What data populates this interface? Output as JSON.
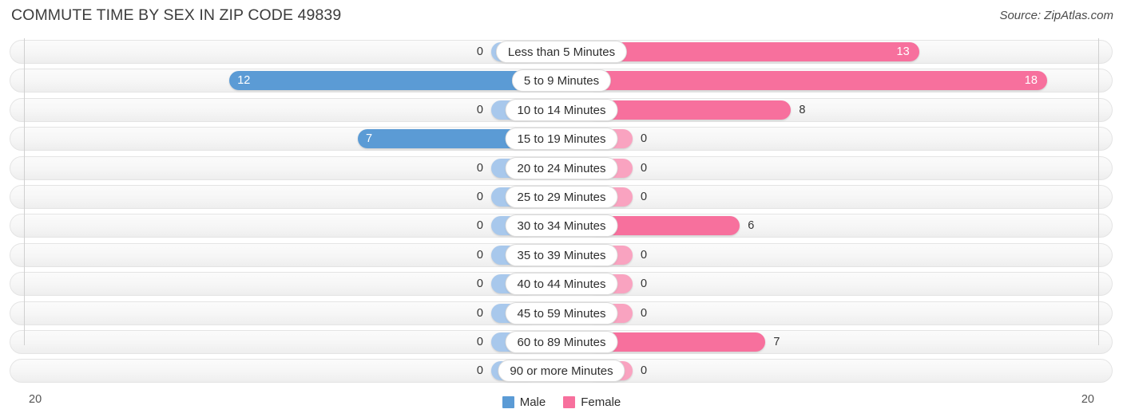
{
  "header": {
    "title": "COMMUTE TIME BY SEX IN ZIP CODE 49839",
    "source": "Source: ZipAtlas.com"
  },
  "legend": {
    "male_label": "Male",
    "female_label": "Female",
    "male_color": "#5b9bd5",
    "female_color": "#f7709d"
  },
  "axis": {
    "left_max_label": "20",
    "right_max_label": "20"
  },
  "chart_data": {
    "type": "bar",
    "subtype": "diverging-bidirectional",
    "title": "COMMUTE TIME BY SEX IN ZIP CODE 49839",
    "xlabel": "",
    "ylabel": "",
    "xlim": [
      20,
      20
    ],
    "grid": true,
    "legend_position": "bottom-center",
    "categories": [
      "Less than 5 Minutes",
      "5 to 9 Minutes",
      "10 to 14 Minutes",
      "15 to 19 Minutes",
      "20 to 24 Minutes",
      "25 to 29 Minutes",
      "30 to 34 Minutes",
      "35 to 39 Minutes",
      "40 to 44 Minutes",
      "45 to 59 Minutes",
      "60 to 89 Minutes",
      "90 or more Minutes"
    ],
    "series": [
      {
        "name": "Male",
        "direction": "left",
        "color": "#5b9bd5",
        "zero_color": "#a8c8ec",
        "values": [
          0,
          12,
          0,
          7,
          0,
          0,
          0,
          0,
          0,
          0,
          0,
          0
        ]
      },
      {
        "name": "Female",
        "direction": "right",
        "color": "#f7709d",
        "zero_color": "#f9a3c0",
        "values": [
          13,
          18,
          8,
          0,
          0,
          0,
          6,
          0,
          0,
          0,
          7,
          0
        ]
      }
    ]
  },
  "rows": [
    {
      "label": "Less than 5 Minutes",
      "male": "0",
      "female": "13"
    },
    {
      "label": "5 to 9 Minutes",
      "male": "12",
      "female": "18"
    },
    {
      "label": "10 to 14 Minutes",
      "male": "0",
      "female": "8"
    },
    {
      "label": "15 to 19 Minutes",
      "male": "7",
      "female": "0"
    },
    {
      "label": "20 to 24 Minutes",
      "male": "0",
      "female": "0"
    },
    {
      "label": "25 to 29 Minutes",
      "male": "0",
      "female": "0"
    },
    {
      "label": "30 to 34 Minutes",
      "male": "0",
      "female": "6"
    },
    {
      "label": "35 to 39 Minutes",
      "male": "0",
      "female": "0"
    },
    {
      "label": "40 to 44 Minutes",
      "male": "0",
      "female": "0"
    },
    {
      "label": "45 to 59 Minutes",
      "male": "0",
      "female": "0"
    },
    {
      "label": "60 to 89 Minutes",
      "male": "0",
      "female": "7"
    },
    {
      "label": "90 or more Minutes",
      "male": "0",
      "female": "0"
    }
  ]
}
